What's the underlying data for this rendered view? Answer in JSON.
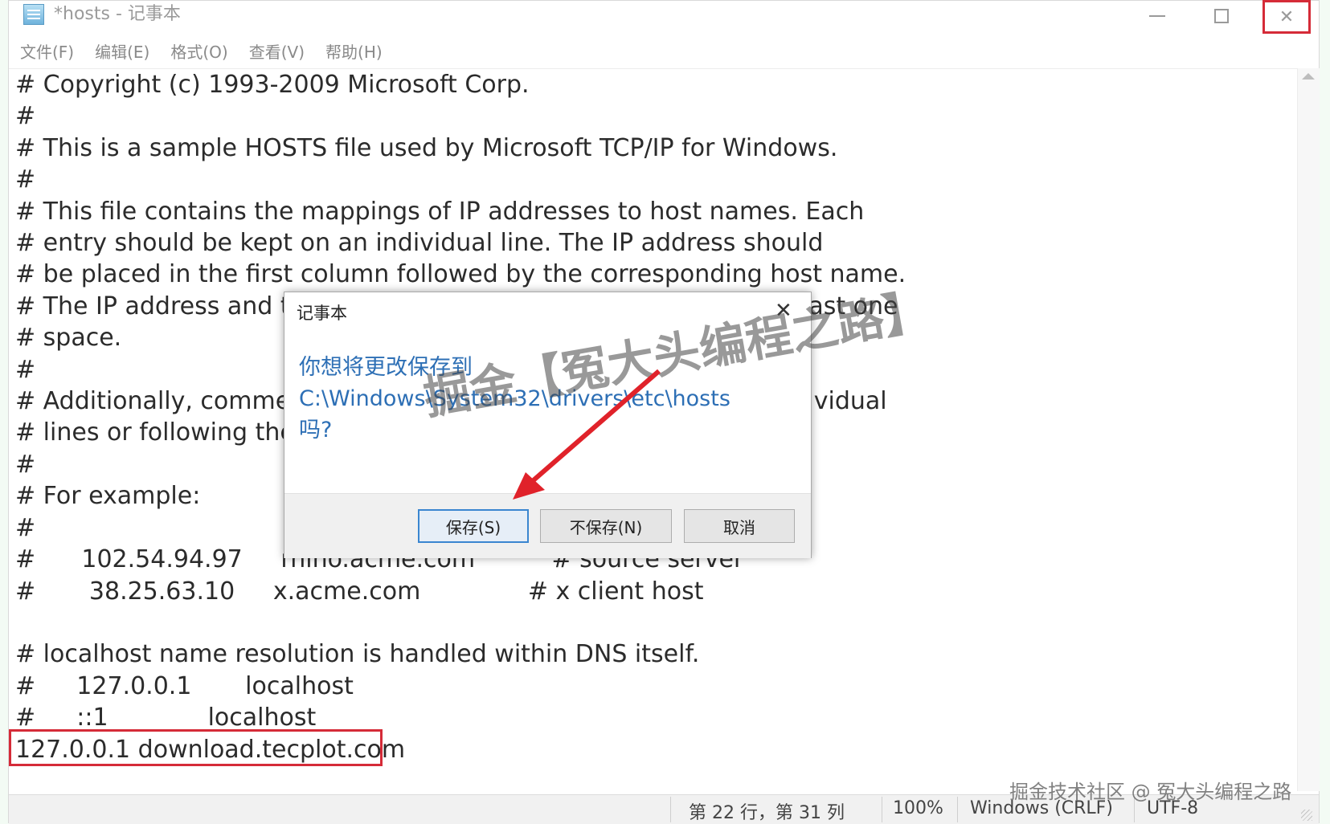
{
  "window": {
    "title": "*hosts - 记事本",
    "menu": [
      "文件(F)",
      "编辑(E)",
      "格式(O)",
      "查看(V)",
      "帮助(H)"
    ]
  },
  "editor": {
    "lines": [
      "# Copyright (c) 1993-2009 Microsoft Corp.",
      "#",
      "# This is a sample HOSTS file used by Microsoft TCP/IP for Windows.",
      "#",
      "# This file contains the mappings of IP addresses to host names. Each",
      "# entry should be kept on an individual line. The IP address should",
      "# be placed in the first column followed by the corresponding host name.",
      "# The IP address and the host name should be separated by at least one",
      "# space.",
      "#",
      "# Additionally, comments (such as these) may be inserted on individual",
      "# lines or following the machine name denoted by a '#' symbol.",
      "#",
      "# For example:",
      "#",
      "#      102.54.94.97     rhino.acme.com          # source server",
      "#       38.25.63.10     x.acme.com              # x client host",
      "",
      "# localhost name resolution is handled within DNS itself.",
      "#\t127.0.0.1       localhost",
      "#\t::1             localhost",
      "127.0.0.1 download.tecplot.com"
    ]
  },
  "statusbar": {
    "position": "第 22 行，第 31 列",
    "zoom": "100%",
    "line_ending": "Windows (CRLF)",
    "encoding": "UTF-8"
  },
  "dialog": {
    "title": "记事本",
    "message_line1": "你想将更改保存到",
    "message_line2": "C:\\Windows\\System32\\drivers\\etc\\hosts",
    "message_line3": "吗?",
    "save": "保存(S)",
    "dont_save": "不保存(N)",
    "cancel": "取消"
  },
  "watermarks": {
    "center": "掘金【冤大头编程之路】",
    "bottom": "掘金技术社区 @ 冤大头编程之路"
  }
}
